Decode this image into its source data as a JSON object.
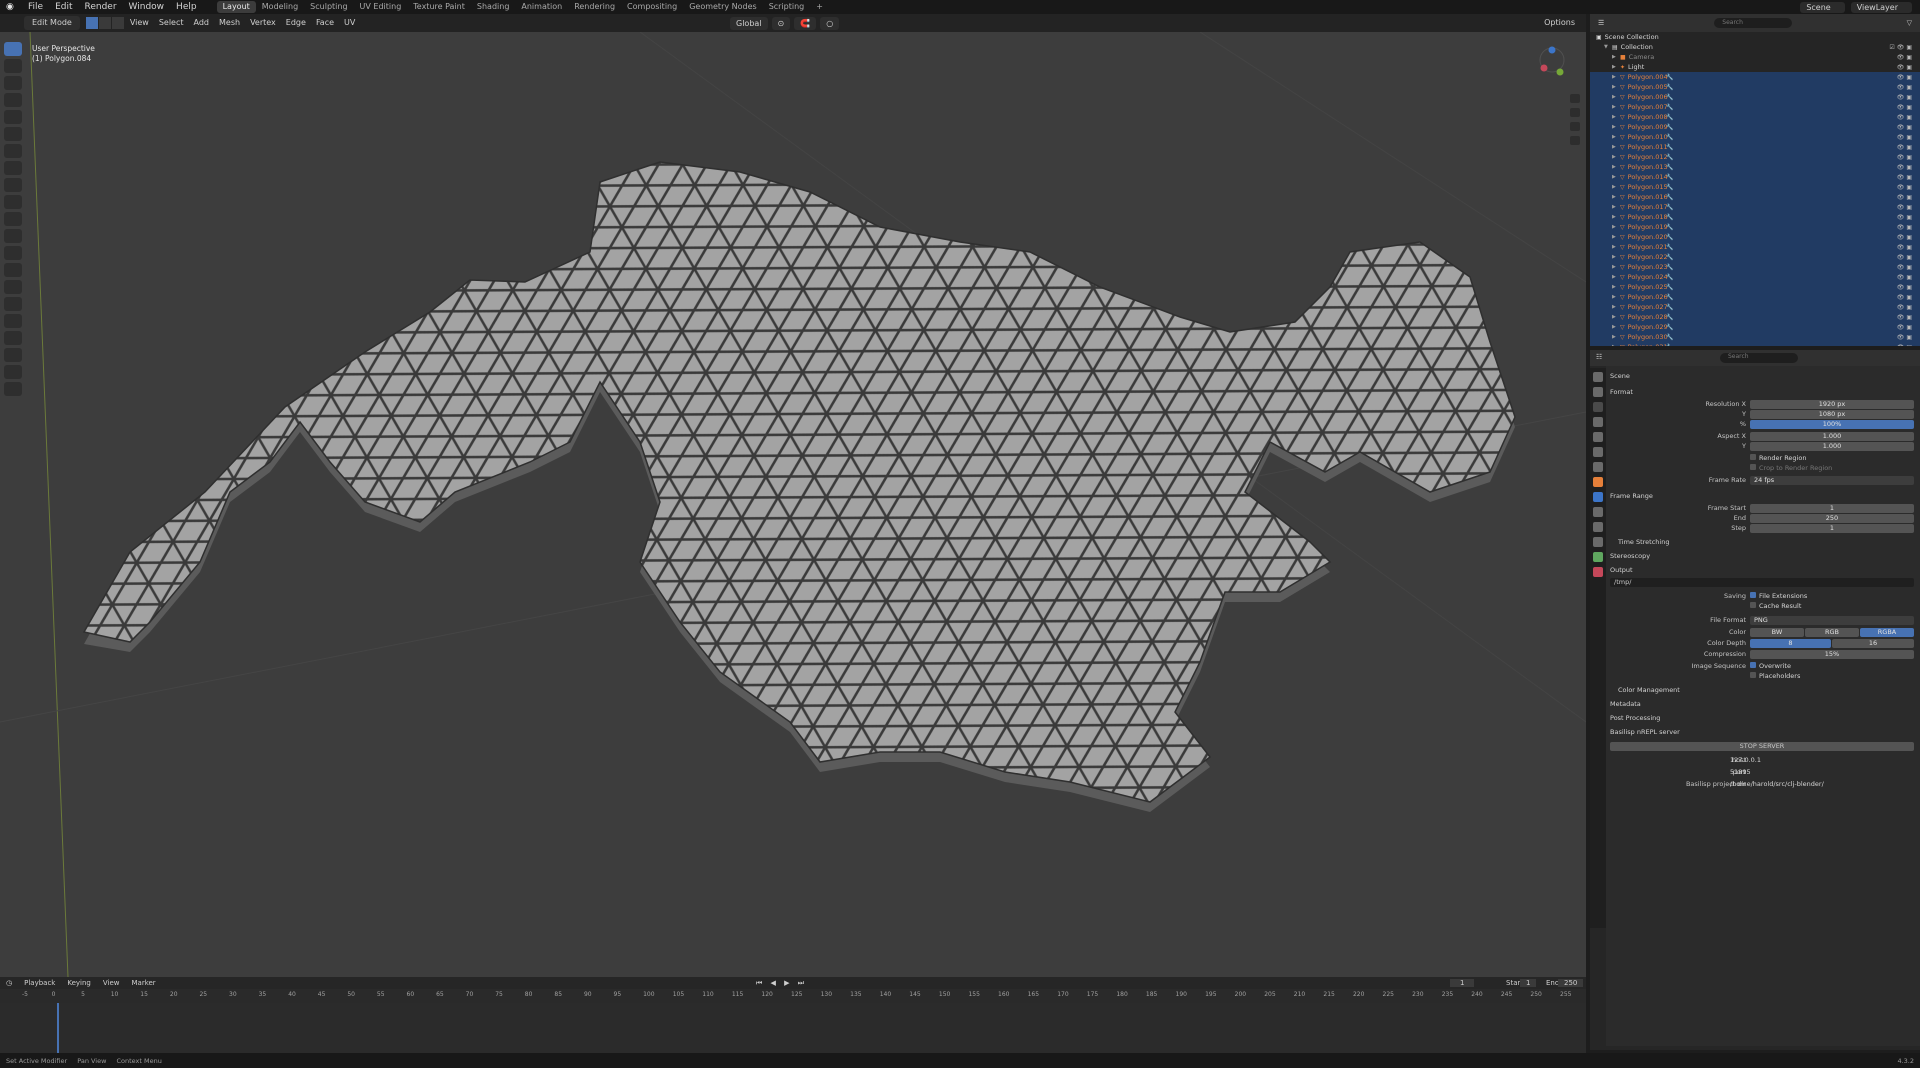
{
  "menus": [
    "File",
    "Edit",
    "Render",
    "Window",
    "Help"
  ],
  "workspaces": [
    {
      "label": "Layout",
      "active": true
    },
    {
      "label": "Modeling",
      "active": false
    },
    {
      "label": "Sculpting",
      "active": false
    },
    {
      "label": "UV Editing",
      "active": false
    },
    {
      "label": "Texture Paint",
      "active": false
    },
    {
      "label": "Shading",
      "active": false
    },
    {
      "label": "Animation",
      "active": false
    },
    {
      "label": "Rendering",
      "active": false
    },
    {
      "label": "Compositing",
      "active": false
    },
    {
      "label": "Geometry Nodes",
      "active": false
    },
    {
      "label": "Scripting",
      "active": false
    }
  ],
  "add_workspace": "+",
  "topbar_right": {
    "scene": "Scene",
    "view_layer": "ViewLayer"
  },
  "viewport_header": {
    "mode": "Edit Mode",
    "menus": [
      "View",
      "Select",
      "Add",
      "Mesh",
      "Vertex",
      "Edge",
      "Face",
      "UV"
    ],
    "orientation": "Global",
    "options": "Options"
  },
  "viewport": {
    "perspective": "User Perspective",
    "object": "(1) Polygon.084"
  },
  "timeline": {
    "menus": [
      "Playback",
      "Keying",
      "View",
      "Marker"
    ],
    "current_frame": "1",
    "start_label": "Start",
    "start": "1",
    "end_label": "End",
    "end": "250",
    "ticks": [
      "-5",
      "0",
      "5",
      "10",
      "15",
      "20",
      "25",
      "30",
      "35",
      "40",
      "45",
      "50",
      "55",
      "60",
      "65",
      "70",
      "75",
      "80",
      "85",
      "90",
      "95",
      "100",
      "105",
      "110",
      "115",
      "120",
      "125",
      "130",
      "135",
      "140",
      "145",
      "150",
      "155",
      "160",
      "165",
      "170",
      "175",
      "180",
      "185",
      "190",
      "195",
      "200",
      "205",
      "210",
      "215",
      "220",
      "225",
      "230",
      "235",
      "240",
      "245",
      "250",
      "255"
    ]
  },
  "status": [
    "Set Active Modifier",
    "Pan View",
    "Context Menu"
  ],
  "version": "4.3.2",
  "outliner": {
    "search_placeholder": "Search",
    "scene_collection": "Scene Collection",
    "collection": "Collection",
    "items": [
      "Camera",
      "Light"
    ],
    "objects": [
      "Polygon.004",
      "Polygon.005",
      "Polygon.006",
      "Polygon.007",
      "Polygon.008",
      "Polygon.009",
      "Polygon.010",
      "Polygon.011",
      "Polygon.012",
      "Polygon.013",
      "Polygon.014",
      "Polygon.015",
      "Polygon.016",
      "Polygon.017",
      "Polygon.018",
      "Polygon.019",
      "Polygon.020",
      "Polygon.021",
      "Polygon.022",
      "Polygon.023",
      "Polygon.024",
      "Polygon.025",
      "Polygon.026",
      "Polygon.027",
      "Polygon.028",
      "Polygon.029",
      "Polygon.030",
      "Polygon.031"
    ]
  },
  "properties": {
    "search_placeholder": "Search",
    "context": "Scene",
    "format": {
      "title": "Format",
      "resolution_x_label": "Resolution X",
      "resolution_x": "1920 px",
      "y_label": "Y",
      "resolution_y": "1080 px",
      "percent_label": "%",
      "percent": "100%",
      "aspect_x_label": "Aspect X",
      "aspect_x": "1.000",
      "aspect_y_label": "Y",
      "aspect_y": "1.000",
      "render_region": "Render Region",
      "crop": "Crop to Render Region",
      "frame_rate_label": "Frame Rate",
      "frame_rate": "24 fps"
    },
    "frame_range": {
      "title": "Frame Range",
      "start_label": "Frame Start",
      "start": "1",
      "end_label": "End",
      "end": "250",
      "step_label": "Step",
      "step": "1",
      "time_stretching": "Time Stretching",
      "stereoscopy": "Stereoscopy"
    },
    "output": {
      "title": "Output",
      "path": "/tmp/",
      "saving_label": "Saving",
      "file_extensions": "File Extensions",
      "cache_result": "Cache Result",
      "file_format_label": "File Format",
      "file_format": "PNG",
      "color_label": "Color",
      "color_options": [
        "BW",
        "RGB",
        "RGBA"
      ],
      "color_depth_label": "Color Depth",
      "color_depth_options": [
        "8",
        "16"
      ],
      "compression_label": "Compression",
      "compression": "15%",
      "image_sequence_label": "Image Sequence",
      "overwrite": "Overwrite",
      "placeholders": "Placeholders",
      "color_management": "Color Management"
    },
    "metadata": "Metadata",
    "post_processing": "Post Processing",
    "repl": {
      "title": "Basilisp nREPL server",
      "button": "STOP SERVER",
      "host_label": "host",
      "host": "127.0.0.1",
      "port_label": "port",
      "port": "51895",
      "project_label": "Basilisp project dir",
      "project": "/home/harold/src/clj-blender/"
    }
  }
}
